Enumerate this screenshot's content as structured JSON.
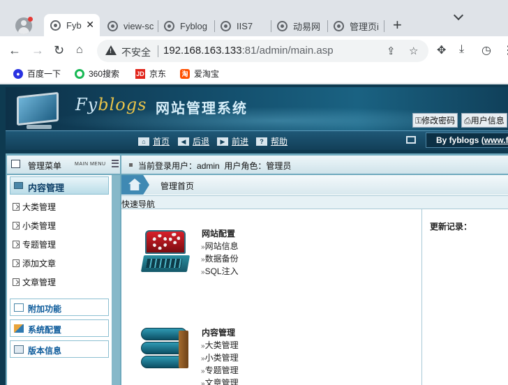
{
  "browser": {
    "tabs": [
      {
        "label": "Fyb",
        "active": true
      },
      {
        "label": "view-sc",
        "active": false
      },
      {
        "label": "Fyblog",
        "active": false
      },
      {
        "label": "IIS7",
        "active": false
      },
      {
        "label": "动易网",
        "active": false
      },
      {
        "label": "管理页i",
        "active": false
      }
    ],
    "insecure_label": "不安全",
    "url_host": "192.168.163.133",
    "url_rest": ":81/admin/main.asp",
    "bookmarks": [
      {
        "label": "百度一下",
        "icon": "baidu-icon",
        "color": "#2932e1"
      },
      {
        "label": "360搜索",
        "icon": "360-icon",
        "color": "#19b955"
      },
      {
        "label": "京东",
        "icon": "jd-icon",
        "color": "#e1251b"
      },
      {
        "label": "爱淘宝",
        "icon": "taobao-icon",
        "color": "#ff5000"
      }
    ]
  },
  "site": {
    "logo_prefix": "Fy",
    "logo_highlight": "blogs",
    "logo_cn": "网站管理系统",
    "top_links": [
      "修改密码",
      "用户信息"
    ],
    "nav": [
      {
        "label": "首页",
        "icon": "home-icon"
      },
      {
        "label": "后退",
        "icon": "back-arrow-icon"
      },
      {
        "label": "前进",
        "icon": "forward-arrow-icon"
      },
      {
        "label": "帮助",
        "icon": "help-icon"
      }
    ],
    "byline_prefix": "By fyblogs ",
    "byline_link": "www.fy"
  },
  "sidebar": {
    "header_title": "管理菜单",
    "header_sub": "MAIN MENU",
    "active_category": "内容管理",
    "items": [
      "大类管理",
      "小类管理",
      "专题管理",
      "添加文章",
      "文章管理"
    ],
    "categories": [
      "附加功能",
      "系统配置",
      "版本信息"
    ]
  },
  "main": {
    "status_user_label": "当前登录用户：",
    "status_user": "admin",
    "status_role_label": "用户角色：",
    "status_role": "管理员",
    "breadcrumb": "管理首页",
    "quick_nav": "快速导航",
    "updates_title": "更新记录：",
    "blocks": [
      {
        "title": "网站配置",
        "links": [
          "网站信息",
          "数据备份",
          "SQL注入"
        ]
      },
      {
        "title": "内容管理",
        "links": [
          "大类管理",
          "小类管理",
          "专题管理",
          "文章管理"
        ]
      }
    ]
  },
  "colors": {
    "chrome_bg": "#dfe3e8",
    "banner_dark": "#0d3148",
    "menu_link": "#0b5a9a"
  }
}
